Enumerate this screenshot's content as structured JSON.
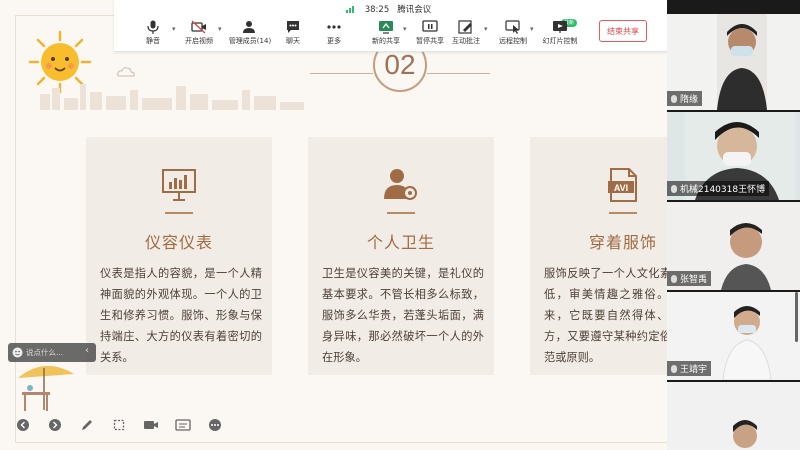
{
  "meeting": {
    "timer": "38:25",
    "app_name": "腾讯会议"
  },
  "toolbar": {
    "buttons": [
      {
        "label": "静音"
      },
      {
        "label": "开启视频"
      },
      {
        "label": "管理成员(14)"
      },
      {
        "label": "聊天"
      },
      {
        "label": "更多"
      },
      {
        "label": "新的共享"
      },
      {
        "label": "暂停共享"
      },
      {
        "label": "互动批注"
      },
      {
        "label": "远程控制"
      },
      {
        "label": "幻灯片控制"
      }
    ],
    "new_badge": "最新",
    "end_share_label": "结束共享"
  },
  "slide": {
    "section_number": "02",
    "cards": [
      {
        "title": "仪容仪表",
        "body": "仪表是指人的容貌，是一个人精神面貌的外观体现。一个人的卫生和修养习惯。服饰、形象与保持端庄、大方的仪表有着密切的关系。"
      },
      {
        "title": "个人卫生",
        "body": "卫生是仪容美的关键，是礼仪的基本要求。不管长相多么标致，服饰多么华贵，若蓬头垢面，满身异味，那必然破坏一个人的外在形象。"
      },
      {
        "title": "穿着服饰",
        "body": "服饰反映了一个人文化素养之高低，审美情趣之雅俗。具体说来，它既要自然得体、协调大方，又要遵守某种约定俗成的规范或原则。"
      }
    ],
    "avi_label": "AVI"
  },
  "comment_box": {
    "placeholder": "说点什么..."
  },
  "participants": [
    {
      "name": "隋缘"
    },
    {
      "name": "机械2140318王怀博"
    },
    {
      "name": "张智禹"
    },
    {
      "name": "王靖宇"
    },
    {
      "name": ""
    }
  ],
  "colors": {
    "accent": "#a06c45",
    "card_bg": "#f2ece6",
    "end_share": "#e04545",
    "badge_green": "#2fbf6a"
  }
}
